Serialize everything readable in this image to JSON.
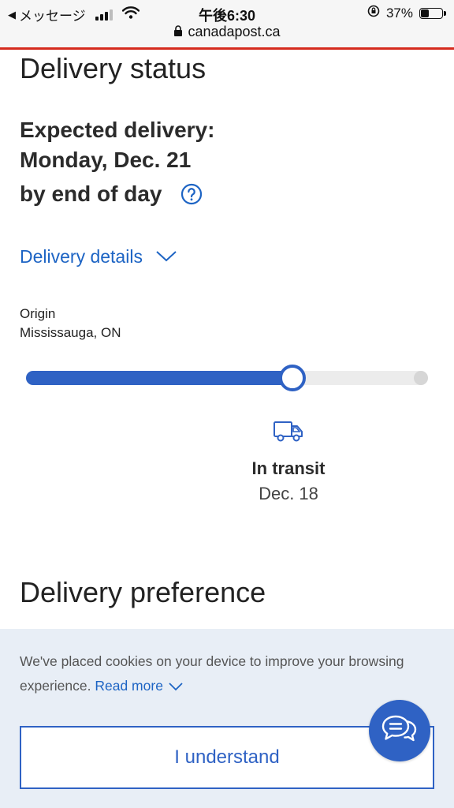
{
  "status_bar": {
    "back_label": "メッセージ",
    "time": "午後6:30",
    "battery": "37%",
    "battery_level": 0.37,
    "url": "canadapost.ca"
  },
  "delivery": {
    "title": "Delivery status",
    "expected_label": "Expected delivery:",
    "expected_date": "Monday, Dec. 21",
    "by_time": "by end of day",
    "details_link": "Delivery details",
    "origin_label": "Origin",
    "origin_value": "Mississauga, ON",
    "progress": 0.66,
    "current_status": "In transit",
    "current_date": "Dec. 18"
  },
  "preference": {
    "title": "Delivery preference"
  },
  "cookie_banner": {
    "text": "We've placed cookies on your device to improve your browsing experience.",
    "read_more": "Read more",
    "button": "I understand"
  },
  "colors": {
    "accent": "#2f62c4",
    "link": "#1d64c4",
    "brand_red": "#d52b1e",
    "banner_bg": "#e8eef6"
  },
  "icons": [
    "back-arrow-icon",
    "signal-icon",
    "wifi-icon",
    "rotation-lock-icon",
    "battery-icon",
    "lock-icon",
    "help-icon",
    "chevron-down-icon",
    "truck-icon",
    "chat-icon"
  ]
}
